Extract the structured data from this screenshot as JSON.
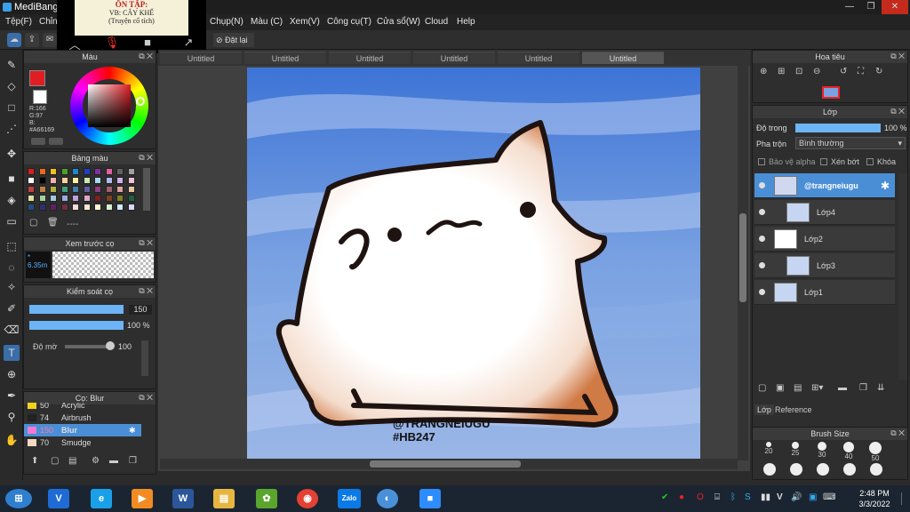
{
  "window": {
    "title": "MediBang P"
  },
  "menu": [
    "Tệp(F)",
    "Chỉn",
    "Chụp(N)",
    "Màu (C)",
    "Xem(V)",
    "Công cụ(T)",
    "Cửa sổ(W)",
    "Cloud",
    "Help"
  ],
  "toolbar": {
    "reset_label": "Đặt lại"
  },
  "video_overlay": {
    "line1": "ÔN TẬP:",
    "line2": "VB: CÂY KHẾ",
    "line3": "(Truyện cổ tích)"
  },
  "color_panel": {
    "title": "Màu",
    "r": "R:166",
    "g": "G:97",
    "b": "B:",
    "hex": "#A66169",
    "fg_color": "#e11d24",
    "bg_color": "#ffffff"
  },
  "palette_panel": {
    "title": "Bảng màu",
    "dash": "----"
  },
  "preview_panel": {
    "title": "Xem trước cọ",
    "size": "6.35m"
  },
  "brush_control": {
    "title": "Kiểm soát cọ",
    "size_value": "150",
    "opacity_value": "100 %",
    "hardness_label": "Độ mờ",
    "hardness_value": "100"
  },
  "brush_list": {
    "title": "Cọ: Blur",
    "items": [
      {
        "size": "50",
        "name": "Acrylic",
        "color": "#f2d21b"
      },
      {
        "size": "74",
        "name": "Airbrush",
        "color": "#222222"
      },
      {
        "size": "150",
        "name": "Blur",
        "color": "#f07ad0",
        "selected": true
      },
      {
        "size": "70",
        "name": "Smudge",
        "color": "#f7d9c2"
      }
    ]
  },
  "doc_tabs": [
    "Untitled",
    "Untitled",
    "Untitled",
    "Untitled",
    "Untitled",
    "Untitled"
  ],
  "artwork": {
    "watermark1": "@TRANGNEIUGU",
    "watermark2": "#HB247"
  },
  "navigator": {
    "title": "Hoa tiêu"
  },
  "layers_panel": {
    "title": "Lớp",
    "opacity_label": "Độ trong",
    "opacity_value": "100 %",
    "blend_label": "Pha trộn",
    "blend_value": "Bình thường",
    "protect_alpha": "Bảo vệ alpha",
    "clipping": "Xén bớt",
    "lock": "Khóa",
    "layers": [
      {
        "name": "@trangneiugu",
        "selected": true
      },
      {
        "name": "Lớp4"
      },
      {
        "name": "Lớp2"
      },
      {
        "name": "Lớp3"
      },
      {
        "name": "Lớp1"
      }
    ],
    "tabs": [
      "Lớp",
      "Reference"
    ]
  },
  "brush_size_panel": {
    "title": "Brush Size",
    "sizes": [
      "20",
      "25",
      "30",
      "40",
      "50"
    ]
  },
  "taskbar": {
    "time": "2:48 PM",
    "date": "3/3/2022",
    "zalo": "Zalo",
    "word": "W",
    "lang": "V"
  }
}
